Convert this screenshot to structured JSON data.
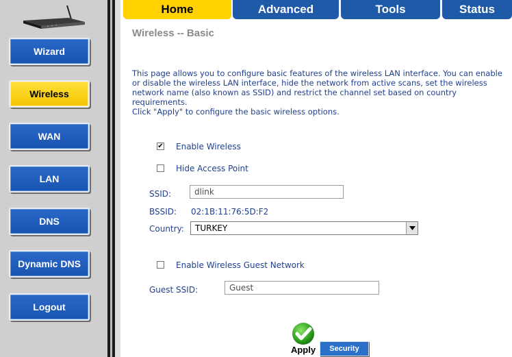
{
  "sidebar": {
    "router_icon": "router-icon",
    "items": [
      {
        "label": "Wizard",
        "active": false
      },
      {
        "label": "Wireless",
        "active": true
      },
      {
        "label": "WAN",
        "active": false
      },
      {
        "label": "LAN",
        "active": false
      },
      {
        "label": "DNS",
        "active": false
      },
      {
        "label": "Dynamic DNS",
        "active": false
      },
      {
        "label": "Logout",
        "active": false
      }
    ]
  },
  "tabs": [
    {
      "label": "Home",
      "active": true
    },
    {
      "label": "Advanced",
      "active": false
    },
    {
      "label": "Tools",
      "active": false
    },
    {
      "label": "Status",
      "active": false
    }
  ],
  "page": {
    "title": "Wireless -- Basic",
    "description": "This page allows you to configure basic features of the wireless LAN interface. You can enable or disable the wireless LAN interface, hide the network from active scans, set the wireless network name (also known as SSID) and restrict the channel set based on country requirements.\nClick \"Apply\" to configure the basic wireless options."
  },
  "form": {
    "enable_wireless": {
      "label": "Enable Wireless",
      "checked": true
    },
    "hide_access_point": {
      "label": "Hide Access Point",
      "checked": false
    },
    "ssid": {
      "label": "SSID:",
      "value": "dlink"
    },
    "bssid": {
      "label": "BSSID:",
      "value": "02:1B:11:76:5D:F2"
    },
    "country": {
      "label": "Country:",
      "value": "TURKEY"
    },
    "guest_network": {
      "label": "Enable Wireless Guest Network",
      "checked": false
    },
    "guest_ssid": {
      "label": "Guest SSID:",
      "value": "Guest"
    }
  },
  "actions": {
    "apply_label": "Apply",
    "apply_icon": "checkmark-icon",
    "security_label": "Security"
  },
  "colors": {
    "nav_blue": "#1e5aa8",
    "nav_active_yellow": "#ffd200",
    "text_blue": "#1f3f8f",
    "title_gray": "#8a8a8a",
    "sidebar_gray": "#cfcfcf"
  }
}
